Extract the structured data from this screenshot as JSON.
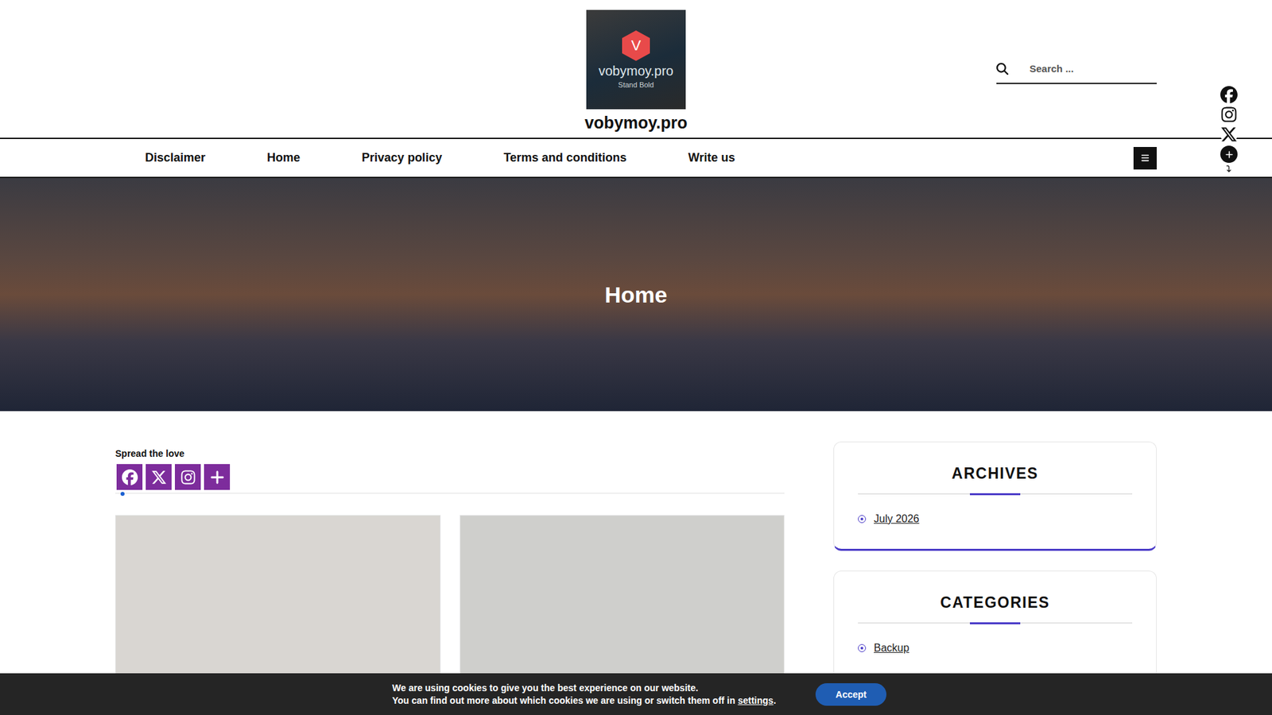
{
  "site": {
    "title": "vobymoy.pro",
    "logo": {
      "letter": "V",
      "name": "vobymoy.pro",
      "tagline": "Stand Bold"
    }
  },
  "search": {
    "placeholder": "Search ..."
  },
  "nav": {
    "items": [
      "Disclaimer",
      "Home",
      "Privacy policy",
      "Terms and conditions",
      "Write us"
    ]
  },
  "floating_social": [
    {
      "kind": "facebook"
    },
    {
      "kind": "instagram"
    },
    {
      "kind": "x"
    },
    {
      "kind": "more"
    }
  ],
  "hero": {
    "title": "Home"
  },
  "share": {
    "label": "Spread the love",
    "buttons": [
      {
        "kind": "facebook"
      },
      {
        "kind": "x"
      },
      {
        "kind": "instagram"
      },
      {
        "kind": "more"
      }
    ]
  },
  "posts": [
    {
      "color": "#d9d6d2"
    },
    {
      "color": "#cfcfcc"
    }
  ],
  "sidebar": {
    "widgets": [
      {
        "title": "ARCHIVES",
        "items": [
          "July 2026"
        ]
      },
      {
        "title": "CATEGORIES",
        "items": [
          "Backup"
        ]
      }
    ]
  },
  "cookie": {
    "line1": "We are using cookies to give you the best experience on our website.",
    "line2": "You can find out more about which cookies we are using or switch them off in ",
    "link": "settings",
    "end": ".",
    "button": "Accept"
  }
}
